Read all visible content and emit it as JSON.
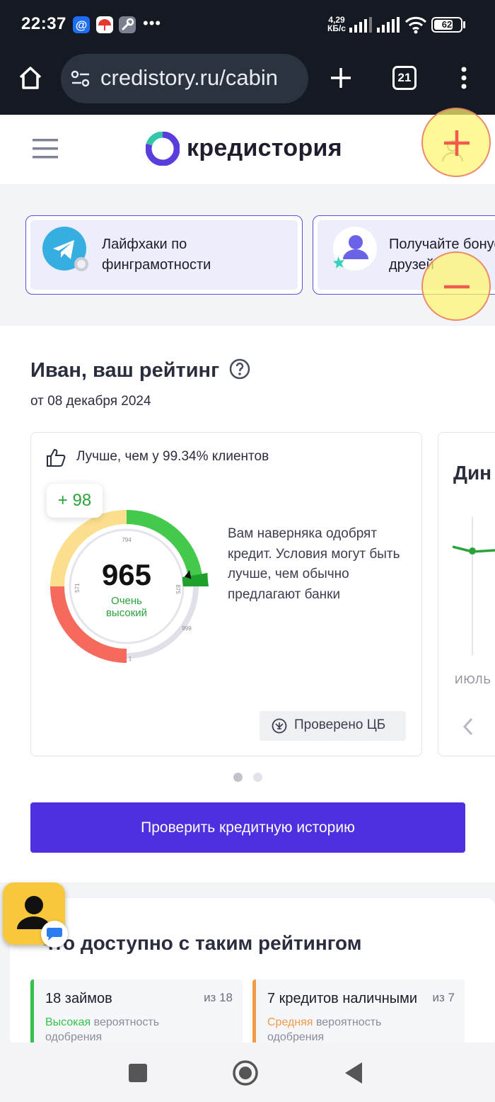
{
  "status_bar": {
    "time": "22:37",
    "speed": "4,29",
    "speed_unit": "КБ/с",
    "battery": "62"
  },
  "browser": {
    "url": "credistory.ru/cabin",
    "tab_count": "21"
  },
  "site": {
    "logo": "кредистория"
  },
  "promo": {
    "cards": [
      {
        "text": "Лайфхаки по финграмотности"
      },
      {
        "text": "Получайте бонусы за друзей"
      }
    ]
  },
  "rating": {
    "title": "Иван, ваш рейтинг",
    "date": "от 08 декабря 2024",
    "comparison": "Лучше, чем у 99.34% клиентов",
    "delta": "+ 98",
    "score": "965",
    "score_label_line1": "Очень",
    "score_label_line2": "высокий",
    "gauge_ticks": {
      "t1": "1",
      "t571": "571",
      "t794": "794",
      "t875": "875",
      "t999": "999"
    },
    "gauge_value_fraction": 0.965,
    "description": "Вам наверняка одобрят кредит. Условия могут быть лучше, чем обычно предлагают банки",
    "verified": "Проверено ЦБ",
    "second_card_title": "Дин",
    "second_card_month": "июль",
    "check_button": "Проверить кредитную историю"
  },
  "available": {
    "title": "Что доступно с таким рейтингом",
    "offers": [
      {
        "title": "18 займов",
        "of": "из 18",
        "level": "Высокая",
        "level_rest": " вероятность",
        "line2": "одобрения",
        "color": "#35c24a"
      },
      {
        "title": "7 кредитов наличными",
        "of": "из 7",
        "level": "Средняя",
        "level_rest": " вероятность",
        "line2": "одобрения",
        "color": "#f29a4a"
      }
    ]
  },
  "colors": {
    "accent": "#4f2fe0",
    "green": "#2aa33a",
    "gauge_red": "#f66a5d",
    "gauge_yellow": "#fbdf8e",
    "gauge_green": "#44c94d",
    "gauge_darkgreen": "#1fa02a"
  }
}
